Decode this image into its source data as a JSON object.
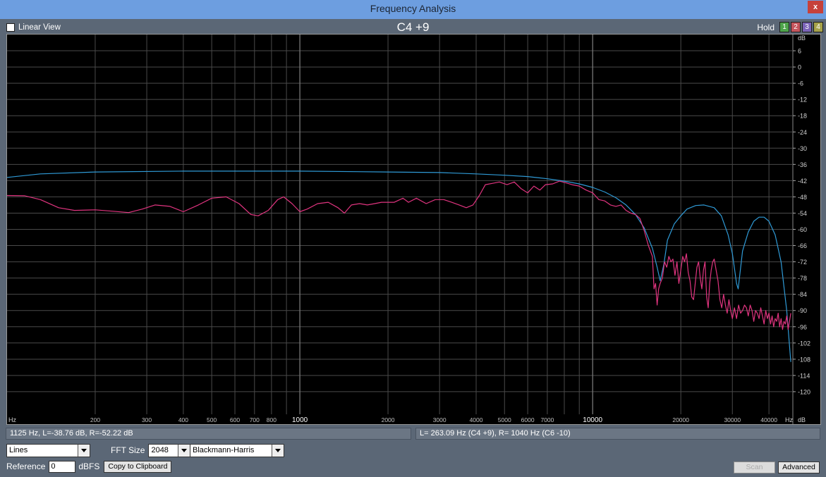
{
  "window": {
    "title": "Frequency Analysis",
    "close_label": "x"
  },
  "toolbar": {
    "linear_view_label": "Linear View",
    "linear_view_checked": false,
    "note_display": "C4 +9",
    "hold_label": "Hold",
    "hold_buttons": [
      {
        "label": "1",
        "color": "#4da44a"
      },
      {
        "label": "2",
        "color": "#c4545c"
      },
      {
        "label": "3",
        "color": "#7a63b8"
      },
      {
        "label": "4",
        "color": "#a6a24a"
      }
    ]
  },
  "status": {
    "cursor": "1125 Hz, L=-38.76 dB, R=-52.22 dB",
    "peaks": "L= 263.09 Hz (C4 +9), R=   1040 Hz (C6 -10)"
  },
  "controls": {
    "display_mode": "Lines",
    "fft_size_label": "FFT Size",
    "fft_size": "2048",
    "window_function": "Blackmann-Harris",
    "reference_label": "Reference",
    "reference_value": "0",
    "reference_unit": "dBFS",
    "copy_button": "Copy to Clipboard",
    "scan_button": "Scan",
    "advanced_button": "Advanced"
  },
  "chart_data": {
    "type": "line",
    "xscale": "log",
    "xlim": [
      100,
      48000
    ],
    "ylim": [
      -132,
      12
    ],
    "x_unit_label": "Hz",
    "y_unit_label": "dB",
    "x_ticks": [
      {
        "v": 200,
        "label": "200"
      },
      {
        "v": 300,
        "label": "300"
      },
      {
        "v": 400,
        "label": "400"
      },
      {
        "v": 500,
        "label": "500"
      },
      {
        "v": 600,
        "label": "600"
      },
      {
        "v": 700,
        "label": "700"
      },
      {
        "v": 800,
        "label": "800"
      },
      {
        "v": 1000,
        "label": "1000",
        "major": true
      },
      {
        "v": 2000,
        "label": "2000"
      },
      {
        "v": 3000,
        "label": "3000"
      },
      {
        "v": 4000,
        "label": "4000"
      },
      {
        "v": 5000,
        "label": "5000"
      },
      {
        "v": 6000,
        "label": "6000"
      },
      {
        "v": 7000,
        "label": "7000"
      },
      {
        "v": 10000,
        "label": "10000",
        "major": true
      },
      {
        "v": 20000,
        "label": "20000"
      },
      {
        "v": 30000,
        "label": "30000"
      },
      {
        "v": 40000,
        "label": "40000"
      }
    ],
    "x_minor": [
      900,
      8000,
      9000
    ],
    "y_ticks": [
      6,
      0,
      -6,
      -12,
      -18,
      -24,
      -30,
      -36,
      -42,
      -48,
      -54,
      -60,
      -66,
      -72,
      -78,
      -84,
      -90,
      -96,
      -102,
      -108,
      -114,
      -120
    ],
    "colors": {
      "left_channel": "#2f9ad6",
      "right_channel": "#e0347f",
      "grid": "#4a4a4a",
      "grid_major": "#777777"
    },
    "series": [
      {
        "channel": "L",
        "color": "#2f9ad6",
        "points": [
          [
            100,
            -40.8
          ],
          [
            130,
            -39.5
          ],
          [
            200,
            -38.8
          ],
          [
            400,
            -38.5
          ],
          [
            1000,
            -38.5
          ],
          [
            2000,
            -38.8
          ],
          [
            3000,
            -39
          ],
          [
            4000,
            -39.5
          ],
          [
            5000,
            -40
          ],
          [
            6000,
            -40.5
          ],
          [
            7000,
            -41.3
          ],
          [
            8000,
            -42.2
          ],
          [
            9000,
            -43.2
          ],
          [
            10000,
            -44.5
          ],
          [
            11000,
            -46.2
          ],
          [
            12000,
            -48.3
          ],
          [
            13000,
            -51
          ],
          [
            14000,
            -54.5
          ],
          [
            15000,
            -59.5
          ],
          [
            16000,
            -67
          ],
          [
            16600,
            -74
          ],
          [
            17000,
            -79
          ],
          [
            17500,
            -73
          ],
          [
            18000,
            -64
          ],
          [
            19000,
            -58
          ],
          [
            20000,
            -55
          ],
          [
            21000,
            -52.5
          ],
          [
            22500,
            -51.2
          ],
          [
            24000,
            -51
          ],
          [
            26000,
            -52
          ],
          [
            27500,
            -55
          ],
          [
            29000,
            -62
          ],
          [
            30000,
            -69
          ],
          [
            31000,
            -80
          ],
          [
            31400,
            -82
          ],
          [
            32500,
            -68
          ],
          [
            34000,
            -61
          ],
          [
            35500,
            -57
          ],
          [
            37000,
            -55.5
          ],
          [
            38500,
            -55.5
          ],
          [
            40000,
            -57
          ],
          [
            42000,
            -62
          ],
          [
            44000,
            -72
          ],
          [
            46000,
            -90
          ],
          [
            47500,
            -109
          ]
        ]
      },
      {
        "channel": "R",
        "color": "#e0347f",
        "points": [
          [
            100,
            -47.5
          ],
          [
            115,
            -47.6
          ],
          [
            130,
            -49
          ],
          [
            150,
            -52
          ],
          [
            170,
            -53
          ],
          [
            200,
            -52.8
          ],
          [
            230,
            -53.3
          ],
          [
            260,
            -53.8
          ],
          [
            290,
            -52.5
          ],
          [
            320,
            -51
          ],
          [
            360,
            -51.5
          ],
          [
            400,
            -53.5
          ],
          [
            450,
            -51
          ],
          [
            500,
            -48.5
          ],
          [
            560,
            -48
          ],
          [
            620,
            -50.5
          ],
          [
            680,
            -54.5
          ],
          [
            720,
            -55
          ],
          [
            780,
            -53
          ],
          [
            840,
            -49
          ],
          [
            880,
            -48
          ],
          [
            940,
            -50.5
          ],
          [
            1000,
            -53.5
          ],
          [
            1060,
            -52.5
          ],
          [
            1150,
            -50.5
          ],
          [
            1250,
            -50
          ],
          [
            1350,
            -52
          ],
          [
            1420,
            -54
          ],
          [
            1500,
            -51
          ],
          [
            1600,
            -50.5
          ],
          [
            1700,
            -51
          ],
          [
            1800,
            -50.5
          ],
          [
            1900,
            -50
          ],
          [
            2100,
            -50
          ],
          [
            2250,
            -48.5
          ],
          [
            2350,
            -50
          ],
          [
            2500,
            -48.5
          ],
          [
            2700,
            -50.5
          ],
          [
            2900,
            -49
          ],
          [
            3100,
            -49
          ],
          [
            3300,
            -50
          ],
          [
            3500,
            -51
          ],
          [
            3700,
            -52
          ],
          [
            3900,
            -51
          ],
          [
            4100,
            -47.5
          ],
          [
            4300,
            -43.5
          ],
          [
            4550,
            -43
          ],
          [
            4800,
            -42.5
          ],
          [
            5100,
            -43.5
          ],
          [
            5400,
            -42.5
          ],
          [
            5700,
            -45
          ],
          [
            6000,
            -46.5
          ],
          [
            6300,
            -44
          ],
          [
            6600,
            -45.5
          ],
          [
            6900,
            -43.5
          ],
          [
            7300,
            -43.2
          ],
          [
            7700,
            -42.2
          ],
          [
            8100,
            -42.8
          ],
          [
            8500,
            -43.5
          ],
          [
            9000,
            -44
          ],
          [
            9500,
            -45.5
          ],
          [
            10000,
            -46.5
          ],
          [
            10500,
            -49
          ],
          [
            11000,
            -49.5
          ],
          [
            11500,
            -51
          ],
          [
            12000,
            -51.5
          ],
          [
            12500,
            -51
          ],
          [
            13000,
            -53
          ],
          [
            13500,
            -54
          ],
          [
            14000,
            -54.5
          ],
          [
            14500,
            -56
          ],
          [
            15000,
            -60.5
          ],
          [
            15500,
            -66
          ],
          [
            16000,
            -70
          ],
          [
            16200,
            -82
          ],
          [
            16400,
            -80
          ],
          [
            16600,
            -88
          ],
          [
            16800,
            -82
          ],
          [
            17000,
            -80
          ],
          [
            17300,
            -78
          ],
          [
            17600,
            -72
          ],
          [
            17900,
            -74
          ],
          [
            18200,
            -70
          ],
          [
            18500,
            -72
          ],
          [
            18800,
            -71
          ],
          [
            19100,
            -77
          ],
          [
            19400,
            -72
          ],
          [
            19700,
            -80
          ],
          [
            20000,
            -75
          ],
          [
            20300,
            -70
          ],
          [
            20600,
            -72
          ],
          [
            20900,
            -69
          ],
          [
            21200,
            -76
          ],
          [
            21500,
            -79
          ],
          [
            21800,
            -85
          ],
          [
            22100,
            -86
          ],
          [
            22400,
            -80
          ],
          [
            22700,
            -74
          ],
          [
            23000,
            -72
          ],
          [
            23300,
            -78
          ],
          [
            23600,
            -82
          ],
          [
            23900,
            -75
          ],
          [
            24200,
            -72
          ],
          [
            24500,
            -85
          ],
          [
            24800,
            -89
          ],
          [
            25100,
            -80
          ],
          [
            25400,
            -75
          ],
          [
            25700,
            -72
          ],
          [
            26000,
            -71
          ],
          [
            26400,
            -75
          ],
          [
            26800,
            -79
          ],
          [
            27200,
            -86
          ],
          [
            27600,
            -89
          ],
          [
            28000,
            -84
          ],
          [
            28400,
            -88
          ],
          [
            28800,
            -91
          ],
          [
            29200,
            -86
          ],
          [
            29600,
            -90
          ],
          [
            30000,
            -93
          ],
          [
            30500,
            -89
          ],
          [
            31000,
            -93
          ],
          [
            31500,
            -88
          ],
          [
            32000,
            -91
          ],
          [
            32500,
            -90
          ],
          [
            33000,
            -88
          ],
          [
            33500,
            -89
          ],
          [
            34000,
            -92
          ],
          [
            34500,
            -88
          ],
          [
            35000,
            -90
          ],
          [
            35500,
            -94
          ],
          [
            36000,
            -90
          ],
          [
            36500,
            -91
          ],
          [
            37000,
            -93
          ],
          [
            37500,
            -89
          ],
          [
            38000,
            -92
          ],
          [
            38500,
            -95
          ],
          [
            39000,
            -90
          ],
          [
            39500,
            -93
          ],
          [
            40000,
            -91
          ],
          [
            40500,
            -95
          ],
          [
            41000,
            -92
          ],
          [
            41500,
            -96
          ],
          [
            42000,
            -93
          ],
          [
            42500,
            -94
          ],
          [
            43000,
            -91
          ],
          [
            43500,
            -96
          ],
          [
            44000,
            -93
          ],
          [
            44500,
            -97
          ],
          [
            45000,
            -94
          ],
          [
            45500,
            -95
          ],
          [
            46000,
            -92
          ],
          [
            46500,
            -97
          ],
          [
            47000,
            -94
          ],
          [
            47500,
            -91
          ]
        ]
      }
    ]
  }
}
